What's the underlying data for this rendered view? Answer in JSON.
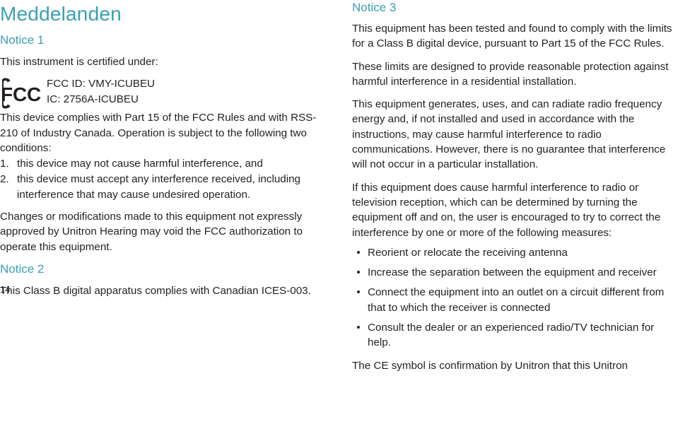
{
  "document": {
    "title": "Meddelanden",
    "page_number": "14",
    "accent_color": "#3a9fb5",
    "text_color": "#231f20"
  },
  "left_column": {
    "notice1": {
      "heading": "Notice 1",
      "intro": "This instrument is certified under:",
      "fcc_logo_name": "fcc-logo",
      "fcc_id": "FCC ID: VMY-ICUBEU",
      "ic_id": "IC: 2756A-ICUBEU",
      "compliance": "This device complies with Part 15 of the FCC Rules and with RSS-210 of Industry Canada.  Operation is subject to the following two conditions:",
      "conditions": [
        {
          "num": "1.",
          "text": "this device may not cause harmful interference, and"
        },
        {
          "num": "2.",
          "text": "this device must accept any interference received, including interference that may cause undesired operation."
        }
      ],
      "changes": "Changes or modifications made to this equipment not expressly approved by Unitron Hearing may void the FCC authorization to operate this equipment."
    },
    "notice2": {
      "heading": "Notice 2",
      "text": "This Class B digital apparatus complies with Canadian ICES-003."
    }
  },
  "right_column": {
    "notice3": {
      "heading": "Notice 3",
      "paragraphs": [
        "This equipment has been tested and found to comply with the limits for a Class B digital device, pursuant to Part 15 of the FCC Rules.",
        "These limits are designed to provide reasonable protection against harmful interference in a residential installation.",
        "This equipment generates, uses, and can radiate radio frequency energy and, if not installed and used in accordance with the instructions, may cause harmful interference to radio communications. However, there is no guarantee that interference will not occur in a particular installation.",
        "If this equipment does cause harmful interference to radio or television reception, which can be determined by turning the equipment off and on, the user is encouraged to try to correct the interference by one or more of the following measures:"
      ],
      "measures": [
        "Reorient or relocate the receiving antenna",
        "Increase the separation between the equipment and receiver",
        "Connect the equipment into an outlet on a circuit different from that to which the receiver is connected",
        "Consult the dealer or an experienced radio/TV technician for help."
      ],
      "closing": "The CE symbol is confirmation by Unitron that this Unitron"
    }
  }
}
